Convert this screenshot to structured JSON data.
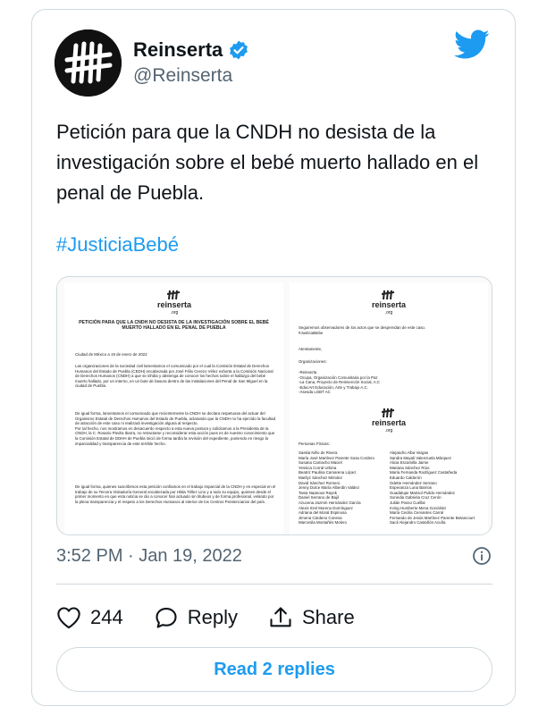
{
  "author": {
    "name": "Reinserta",
    "handle": "@Reinserta"
  },
  "tweet": {
    "text": "Petición para que la CNDH no desista de la investigación sobre el bebé muerto hallado en el penal de Puebla.",
    "hashtag": "#JusticiaBebé",
    "timestamp": "3:52 PM · Jan 19, 2022"
  },
  "document": {
    "left_page": {
      "logo": "reinserta",
      "logo_sub": ".org",
      "title": "PETICIÓN PARA QUE LA CNDH NO DESISTA DE LA INVESTIGACIÓN SOBRE EL BEBÉ MUERTO HALLADO EN EL PENAL DE PUEBLA",
      "date": "Ciudad de México a 19 de enero de 2022",
      "para1": "Las organizaciones de la sociedad civil lamentamos el comunicado por el cual la Comisión Estatal de Derechos Humanos del Estado de Puebla (CEDH) encabezada por José Félix Cerezo Vélez exhorta a la Comisión Nacional de Derechos Humanos (CNDH) a que se inhiba y abstenga de conocer los hechos sobre el hallazgo del bebé muerto hallado, por un interno, en un bote de basura dentro de las instalaciones del Penal de San Miguel en la ciudad de Puebla.",
      "para2": "De igual forma, lamentamos el comunicado que recientemente la CNDH se declara respetuosa del actuar del Organismo Estatal de Derechos Humanos del Estado de Puebla, aclarando que la CNDH no ha ejercido la facultad de atracción de este caso ni realizará investigación alguna al respecto.\nPor tal hecho, nos mostramos en desacuerdo respecto a esta nueva postura y solicitamos a la Presidenta de la CNDH, la C. Rosario Piedra Ibarra, no retractarse y reconsiderar esta acción pues es de nuestro conocimiento que la Comisión Estatal de DDHH de Puebla inició de forma tardía la revisión del expediente, poniendo en riesgo la imparcialidad y transparencia de este terrible hecho.",
      "para3": "De igual forma, quienes suscribimos esta petición confiamos en el trabajo imparcial de la CNDH y en especial en el trabajo de su Tercera Visitaduría General encabezada por Hilda Téllez Lino y a todo su equipo, quienes desde el primer momento en que esta noticia se dio a conocer han actuado sin titubeos y de forma profesional, velando por la plena transparencia y el respeto a los Derechos Humanos al interior de los Centros Penitenciarios del país."
    },
    "right_page": {
      "logo": "reinserta",
      "logo_sub": ".org",
      "intro": "Seguiremos observadores de los actos que se desprendan de este caso.\n#JusticiaBebe",
      "closing": "Atentamente,",
      "orgs_label": "Organizaciones:",
      "orgs": "-Reinserta\n-Ocupa, Organización Comunitaria por la Paz\n-La Cana, Proyecto de Reinserción Social, A.C\n-EducArt Educación, Arte y Trabajo A.C.\n-Asesda LGBT AC",
      "persons_label": "Personas Físicas:",
      "persons_col1": "Saskia Niño de Rivera\nMaría José Martínez Parente Sosa Cordero\nSusana Camacho Maciel\nYessica Corral Urbina\nBeatriz Paulina Camarena López\nMarilyz Sánchez Méndez\nDavid Sánchez Romero\nJenny Dulce María Alberdin Valdez\nTania Naanous Rayek\nDaniel Serrano de Bajil\nAzucena Jazmín Hernández García\nAlexis Itzel Moreno Domínguez\nAdriana del Moral Espinosa\nJimena Cárdeno Conesa\nMarcesila Montañés Molero",
      "persons_col2": "Alejandro Alba Vargas\nSandra Mayali Valenzuela Márquez\nAlicia Escamilla Jaime\nMariana Sánchez Ríos\nMaría Fernanda Rodríguez Castañeda\nEduardo Calderón\nOdette Hernández Serrano\nEsperanza Luna Barrios\nGuadalupe Marisol Pulido Hernández\nSonedia Gabriela Cruz Cerón\nJulián Posso Cuéllar\nIrving Humberto Mena González\nMaría Cecilia Cervantes Carral\nFernando de Jesús Martínez Parente Betancourt\nSacil Alejandro Castañón Acuña"
    }
  },
  "actions": {
    "like_count": "244",
    "reply_label": "Reply",
    "share_label": "Share"
  },
  "read_replies": "Read 2 replies",
  "colors": {
    "accent": "#1d9bf0",
    "verified": "#1d9bf0",
    "muted_text": "#536471",
    "border": "#cfd9de"
  },
  "icons": [
    "reinserta-logo-icon",
    "verified-badge-icon",
    "twitter-bird-icon",
    "info-icon",
    "heart-icon",
    "reply-bubble-icon",
    "share-icon"
  ]
}
